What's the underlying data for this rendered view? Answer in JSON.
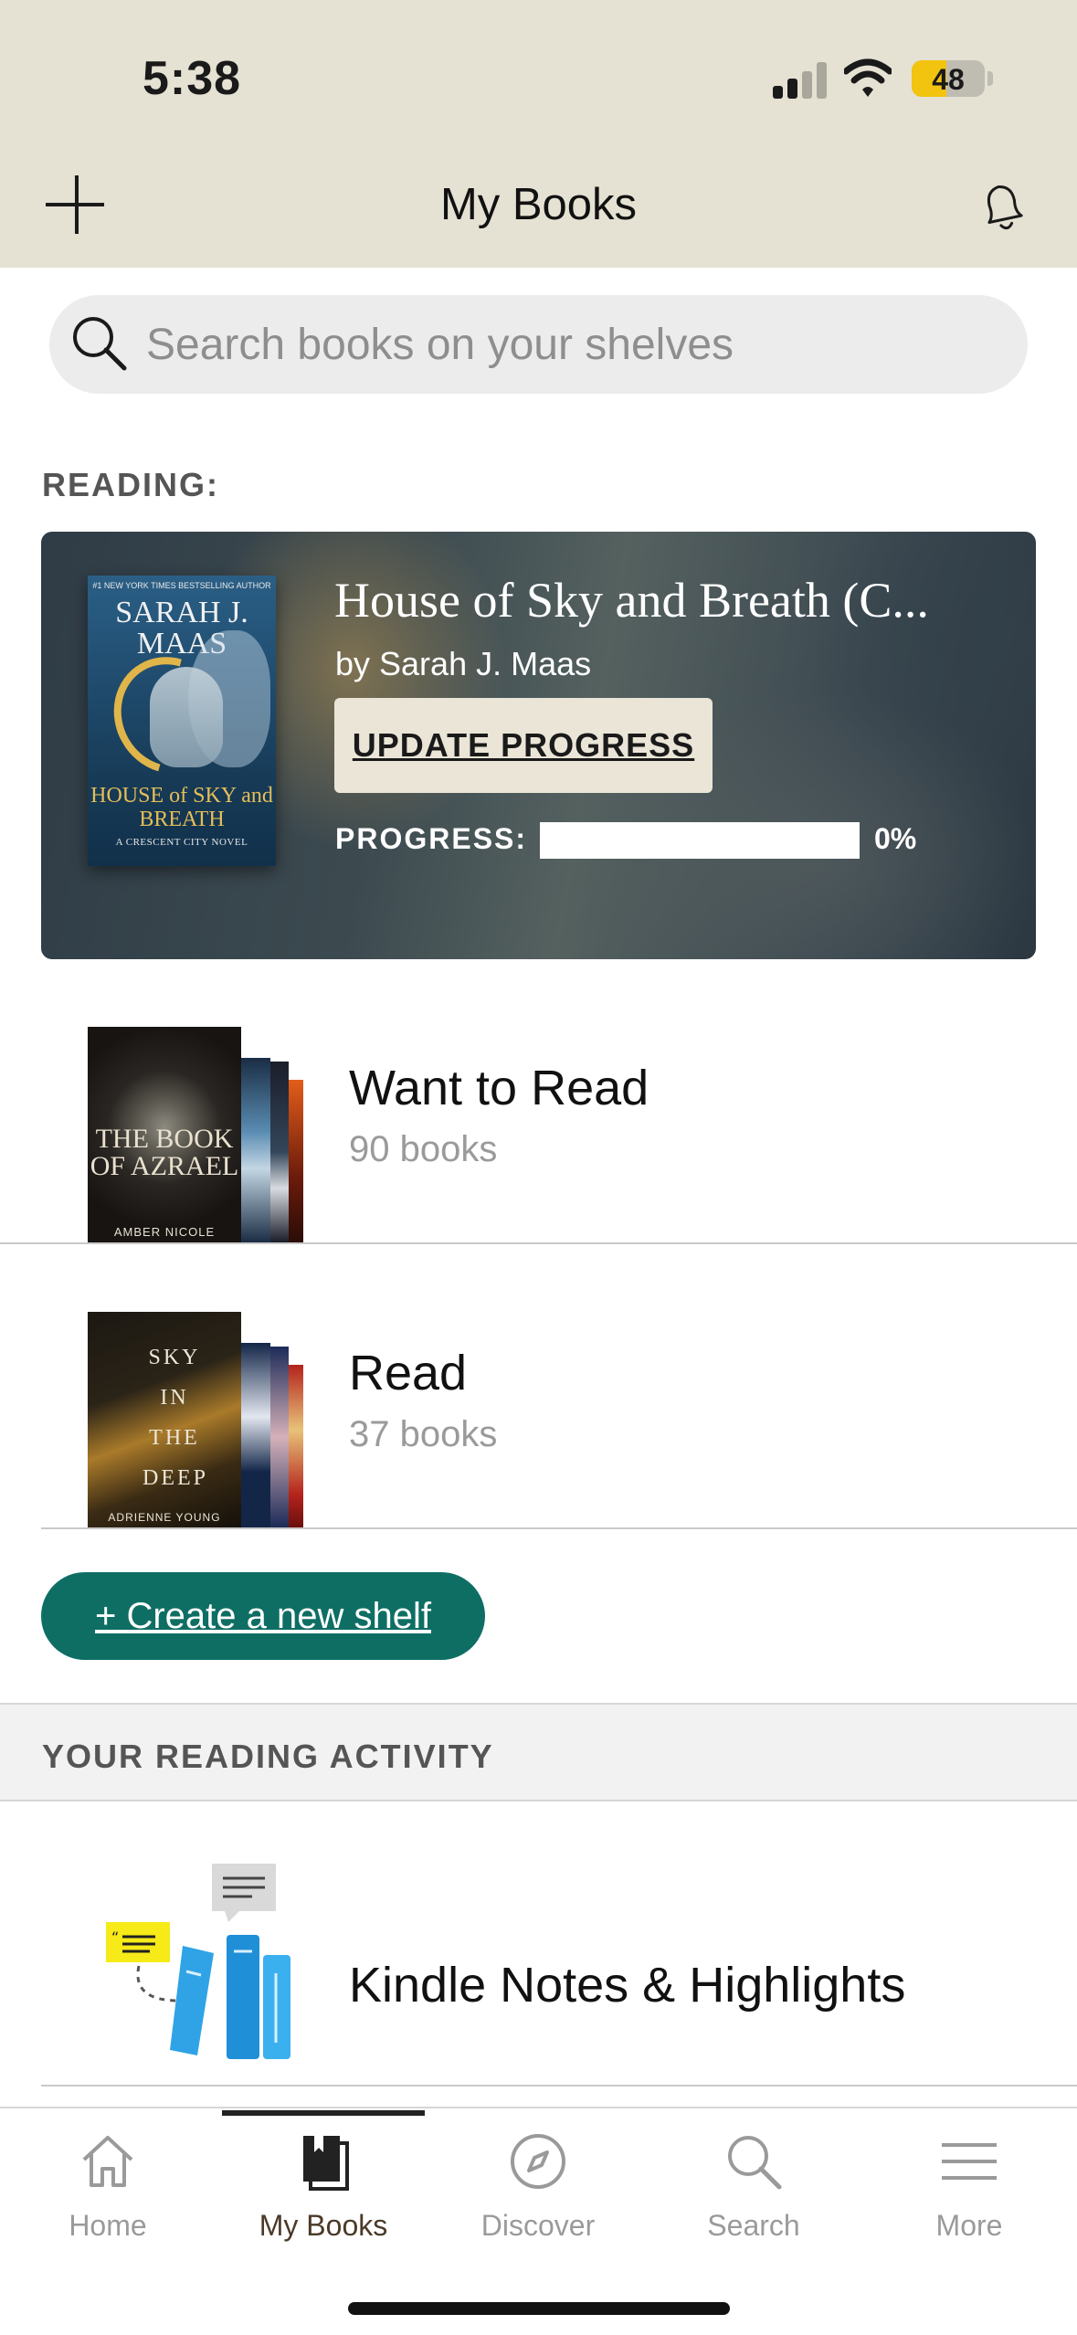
{
  "status_bar": {
    "time": "5:38",
    "battery": "48"
  },
  "header": {
    "title": "My Books",
    "add_icon": "plus-icon",
    "notifications_icon": "bell-icon"
  },
  "search": {
    "placeholder": "Search books on your shelves",
    "value": ""
  },
  "reading": {
    "section_label": "READING:",
    "book": {
      "title": "House of Sky and Breath (C...",
      "author": "by Sarah J. Maas",
      "cover_top": "#1 NEW YORK TIMES BESTSELLING AUTHOR",
      "cover_author": "SARAH J. MAAS",
      "cover_title": "HOUSE of SKY and BREATH",
      "cover_subtitle": "A CRESCENT CITY NOVEL",
      "update_button": "UPDATE PROGRESS",
      "progress_label": "PROGRESS:",
      "progress_text": "0%",
      "progress_value": 0
    }
  },
  "shelves": [
    {
      "name": "Want to Read",
      "count": "90 books",
      "front_cover_title": "THE BOOK OF AZRAEL",
      "front_cover_author": "AMBER NICOLE"
    },
    {
      "name": "Read",
      "count": "37 books",
      "front_cover_title": "SKY IN THE DEEP",
      "front_cover_author": "ADRIENNE YOUNG"
    }
  ],
  "create_shelf": {
    "label": "+ Create a new shelf"
  },
  "activity": {
    "section_label": "YOUR READING ACTIVITY",
    "notes_label": "Kindle Notes & Highlights"
  },
  "tabbar": {
    "tabs": [
      {
        "label": "Home",
        "icon": "home-icon",
        "active": false
      },
      {
        "label": "My Books",
        "icon": "books-icon",
        "active": true
      },
      {
        "label": "Discover",
        "icon": "compass-icon",
        "active": false
      },
      {
        "label": "Search",
        "icon": "search-icon",
        "active": false
      },
      {
        "label": "More",
        "icon": "menu-icon",
        "active": false
      }
    ]
  },
  "colors": {
    "header_bg": "#e5e1d3",
    "accent_teal": "#0e6e64",
    "battery_yellow": "#f2c40f",
    "active_tab": "#4a3a28"
  }
}
